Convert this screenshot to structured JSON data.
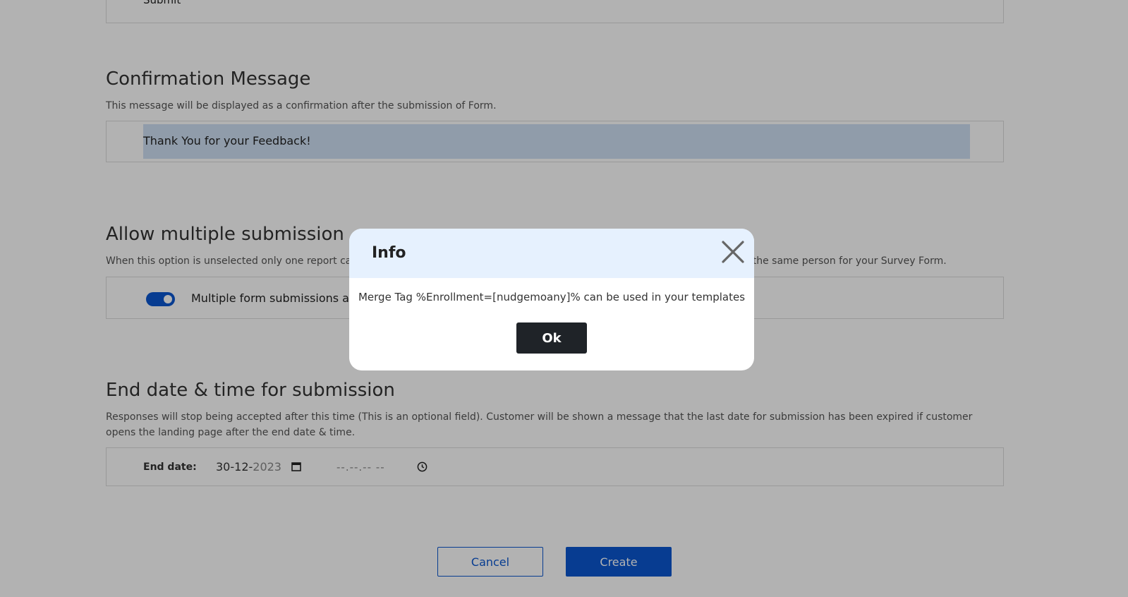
{
  "form": {
    "submit_button_label": "Submit",
    "confirmation": {
      "title": "Confirmation Message",
      "description": "This message will be displayed as a confirmation after the submission of Form.",
      "value": "Thank You for your Feedback!"
    },
    "multiple_submission": {
      "title": "Allow multiple submission",
      "description": "When this option is unselected only one report can be submitted per person. When selected multiple reports can be submitted by the same person for your Survey Form.",
      "toggle_label": "Multiple form submissions are allowed",
      "toggle_on": true
    },
    "end_date": {
      "title": "End date & time for submission",
      "description": "Responses will stop being accepted after this time (This is an optional field). Customer will be shown a message that the last date for submission has been expired if customer opens the landing page after the end date & time.",
      "label": "End date:",
      "date_prefix": "30-12-",
      "date_suffix": "2023",
      "time_placeholder": "--.--.-- --"
    }
  },
  "actions": {
    "cancel_label": "Cancel",
    "create_label": "Create"
  },
  "modal": {
    "title": "Info",
    "message": "Merge Tag %Enrollment=[nudgemoany]% can be used in your templates",
    "ok_label": "Ok"
  },
  "colors": {
    "primary": "#0b57d0",
    "modal_header": "#e6f1fe",
    "ok_button": "#1f2328"
  }
}
